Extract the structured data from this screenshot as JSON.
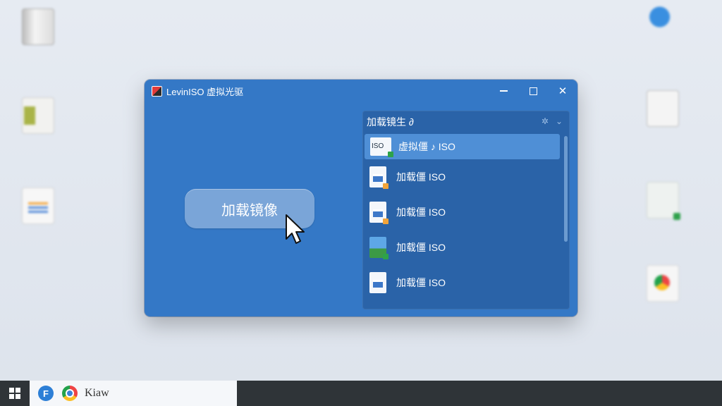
{
  "window": {
    "title": "LevinISO 虚拟光驱",
    "minimize_icon": "minimize-icon",
    "maximize_icon": "maximize-icon",
    "close_label": "✕"
  },
  "main_button": {
    "label": "加载镜像"
  },
  "panel": {
    "title": "加载镜生 ∂",
    "tool_icons": [
      "settings-icon",
      "chevron-down-icon"
    ],
    "items": [
      {
        "label": "虚拟僵 ♪ ISO",
        "icon": "iso-file-icon",
        "icon_text": "ISO",
        "badge_color": "#2ea24a",
        "selected": true
      },
      {
        "label": "加载僵 ISO",
        "icon": "document-file-icon",
        "badge_color": "#f2a43a"
      },
      {
        "label": "加载僵 ISO",
        "icon": "document-file-icon",
        "badge_color": "#f2a43a"
      },
      {
        "label": "加载僵 ISO",
        "icon": "image-file-icon",
        "badge_color": "#2ea24a"
      },
      {
        "label": "加载僵 ISO",
        "icon": "document-file-icon",
        "badge_color": ""
      }
    ]
  },
  "taskbar": {
    "start_icon": "windows-start-icon",
    "apps": [
      "f-app-icon",
      "chrome-icon"
    ],
    "text": "Kiaw"
  },
  "colors": {
    "window_bg": "#3478c6",
    "panel_bg": "#2a63a8",
    "selected_item": "#4f8fd6",
    "taskbar": "#2f3438"
  }
}
